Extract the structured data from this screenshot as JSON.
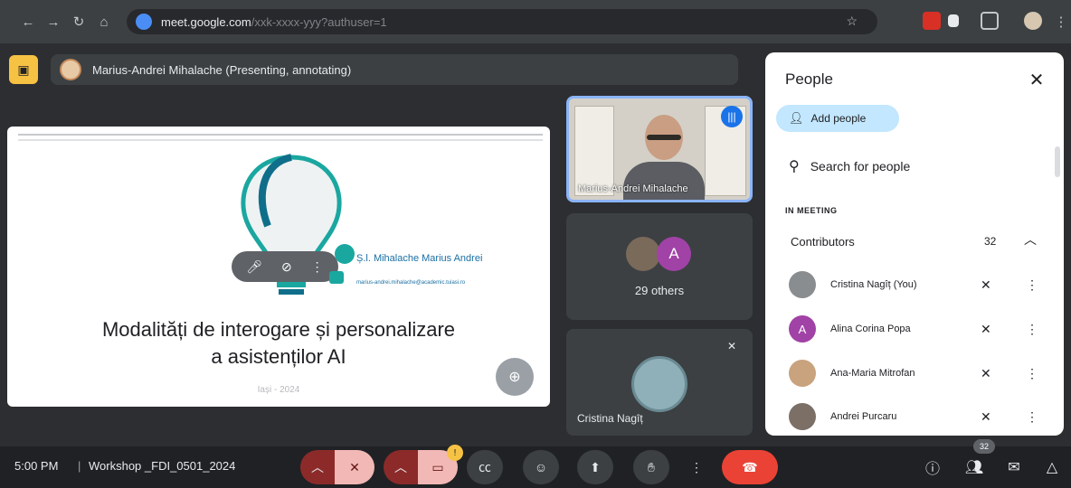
{
  "browser": {
    "url_host": "meet.google.com",
    "url_path": "/xxk-xxxx-yyy?authuser=1"
  },
  "presenter": {
    "label": "Marius-Andrei Mihalache (Presenting, annotating)"
  },
  "slide": {
    "author": "Ș.l. Mihalache Marius Andrei",
    "email": "marius-andrei.mihalache@academic.tuiasi.ro",
    "title_line1": "Modalități de interogare și personalizare",
    "title_line2": "a asistenților AI",
    "year": "Iași - 2024"
  },
  "tiles": {
    "presenter_name": "Marius-Andrei Mihalache",
    "others_avatar_letter": "A",
    "others_label": "29 others",
    "self_name": "Cristina Nagîț"
  },
  "people_panel": {
    "title": "People",
    "add_label": "Add people",
    "search_label": "Search for people",
    "section": "IN MEETING",
    "group_label": "Contributors",
    "group_count": "32",
    "members": [
      {
        "name": "Cristina Nagîț (You)",
        "avatar_letter": "",
        "avatar_color": "#8a8d90"
      },
      {
        "name": "Alina Corina Popa",
        "avatar_letter": "A",
        "avatar_color": "#a142a6"
      },
      {
        "name": "Ana-Maria Mitrofan",
        "avatar_letter": "",
        "avatar_color": "#c9a27e"
      },
      {
        "name": "Andrei Purcaru",
        "avatar_letter": "",
        "avatar_color": "#7b6f66"
      }
    ]
  },
  "bottom_bar": {
    "time": "5:00 PM",
    "separator": "|",
    "meeting_code": "Workshop _FDI_0501_2024",
    "camera_badge": "!",
    "people_count": "32"
  },
  "colors": {
    "accent_blue": "#8ab4f8",
    "end_call": "#ea4335",
    "present_yellow": "#f6c244",
    "add_people_bg": "#c2e7ff"
  }
}
